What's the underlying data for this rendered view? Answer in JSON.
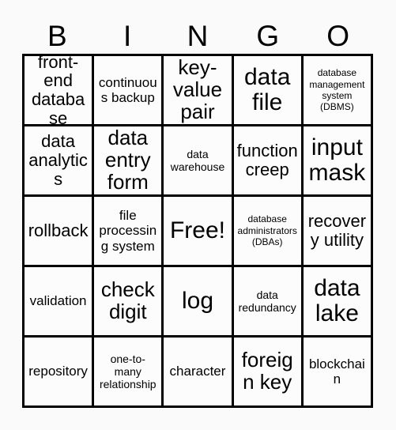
{
  "card": {
    "title": "BINGO",
    "columns": [
      "B",
      "I",
      "N",
      "G",
      "O"
    ],
    "free_space_label": "Free!",
    "colors": {
      "background": "#fafafa",
      "cell_background": "#fcfcfc",
      "border": "#000000",
      "text": "#000000"
    },
    "rows": [
      [
        {
          "label": "front-end database",
          "size": "lg"
        },
        {
          "label": "continuous backup",
          "size": "md"
        },
        {
          "label": "key-value pair",
          "size": "xl"
        },
        {
          "label": "data file",
          "size": "xxl"
        },
        {
          "label": "database management system (DBMS)",
          "size": "xs"
        }
      ],
      [
        {
          "label": "data analytics",
          "size": "lg"
        },
        {
          "label": "data entry form",
          "size": "xl"
        },
        {
          "label": "data warehouse",
          "size": "sm"
        },
        {
          "label": "function creep",
          "size": "lg"
        },
        {
          "label": "input mask",
          "size": "xxl"
        }
      ],
      [
        {
          "label": "rollback",
          "size": "lg"
        },
        {
          "label": "file processing system",
          "size": "md"
        },
        {
          "label": "Free!",
          "size": "xxl",
          "free": true
        },
        {
          "label": "database administrators (DBAs)",
          "size": "xs"
        },
        {
          "label": "recovery utility",
          "size": "lg"
        }
      ],
      [
        {
          "label": "validation",
          "size": "md"
        },
        {
          "label": "check digit",
          "size": "xl"
        },
        {
          "label": "log",
          "size": "xxl"
        },
        {
          "label": "data redundancy",
          "size": "sm"
        },
        {
          "label": "data lake",
          "size": "xxl"
        }
      ],
      [
        {
          "label": "repository",
          "size": "md"
        },
        {
          "label": "one-to-many relationship",
          "size": "sm"
        },
        {
          "label": "character",
          "size": "md"
        },
        {
          "label": "foreign key",
          "size": "xl"
        },
        {
          "label": "blockchain",
          "size": "md"
        }
      ]
    ]
  }
}
